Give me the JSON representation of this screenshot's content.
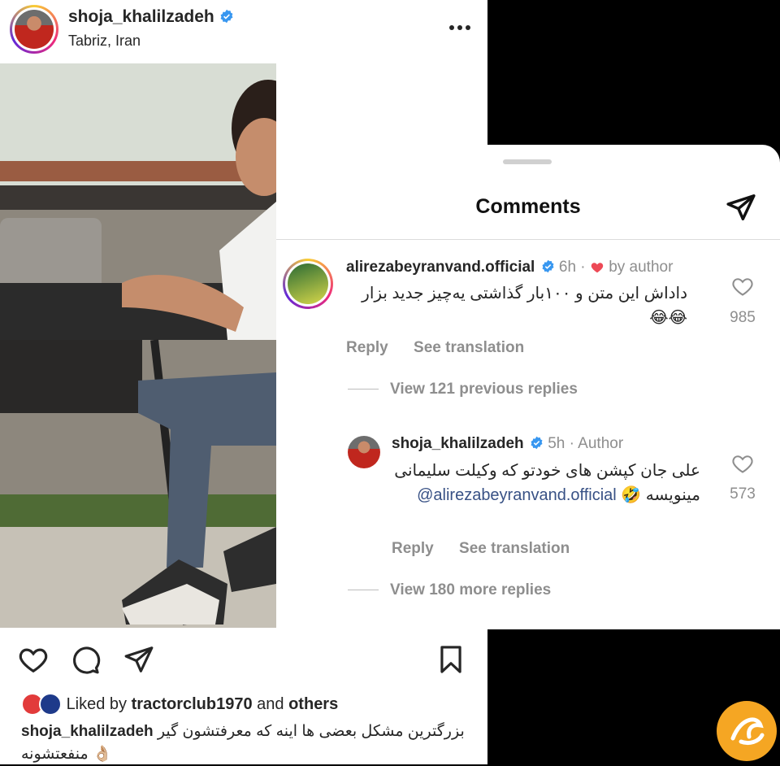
{
  "post": {
    "username": "shoja_khalilzadeh",
    "location": "Tabriz, Iran",
    "liked_prefix": "Liked by",
    "liked_user": "tractorclub1970",
    "liked_and": "and",
    "liked_others": "others",
    "caption_user": "shoja_khalilzadeh",
    "caption_text": "بزرگترین مشکل بعضی ها اینه که معرفتشون گیر منفعتشونه 👌🏼"
  },
  "comments_sheet": {
    "title": "Comments",
    "comments": [
      {
        "username": "alirezabeyranvand.official",
        "time": "6h",
        "liked_by": "by author",
        "text": "داداش این متن و ۱۰۰بار گذاشتی یه‌چیز جدید بزار 😂😂",
        "reply": "Reply",
        "translate": "See translation",
        "likes": "985"
      },
      {
        "username": "shoja_khalilzadeh",
        "time": "5h",
        "tag": "Author",
        "mention": "@alirezabeyranvand.official",
        "text": "علی جان کپشن های خودتو که وکیلت سلیمانی مینویسه 🤣",
        "reply": "Reply",
        "translate": "See translation",
        "likes": "573"
      }
    ],
    "view_previous": "View 121 previous replies",
    "view_more": "View 180 more replies"
  },
  "colors": {
    "verified": "#3897f0",
    "heart_red": "#ed4956",
    "muted": "#8e8e8e",
    "mention": "#385185",
    "watermark": "#f5a623"
  },
  "icons": [
    "more-icon",
    "heart-icon",
    "comment-icon",
    "send-icon",
    "bookmark-icon",
    "share-icon",
    "verified-icon"
  ]
}
